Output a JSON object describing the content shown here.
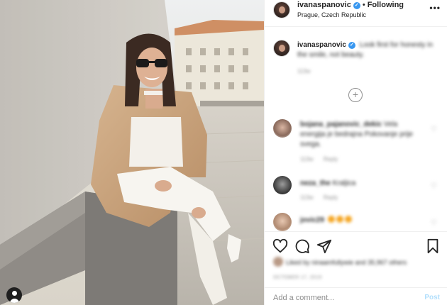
{
  "post": {
    "username": "ivanaspanovic",
    "verified_icon": "verified-badge-icon",
    "separator": "•",
    "follow_status": "Following",
    "location": "Prague, Czech Republic",
    "more_icon": "more-options-icon"
  },
  "caption": {
    "username": "ivanaspanovic",
    "text": "Look first for honesty in the smile, not beauty.",
    "time": "113w"
  },
  "load_more_icon": "plus-circle-icon",
  "comments": [
    {
      "username": "bojana_pajanovic_dekic",
      "text": "Vela energija je bedrajna Pokovanje prije svega.",
      "time": "113w",
      "reply": "Reply"
    },
    {
      "username": "neza_the",
      "text": "Kraljica",
      "time": "113w",
      "reply": "Reply"
    },
    {
      "username": "jovic29",
      "text": "",
      "emoji_count": 3
    }
  ],
  "actions": {
    "like_icon": "heart-icon",
    "comment_icon": "comment-icon",
    "share_icon": "paper-plane-icon",
    "save_icon": "bookmark-icon"
  },
  "likes": {
    "text": "Liked by ninaamfullywie and 35,967 others"
  },
  "date": "OCTOBER 17, 2019",
  "comment_box": {
    "placeholder": "Add a comment...",
    "post_label": "Post"
  },
  "colors": {
    "accent": "#3897f0",
    "post_disabled": "#b2dffc",
    "muted": "#8e8e8e"
  }
}
